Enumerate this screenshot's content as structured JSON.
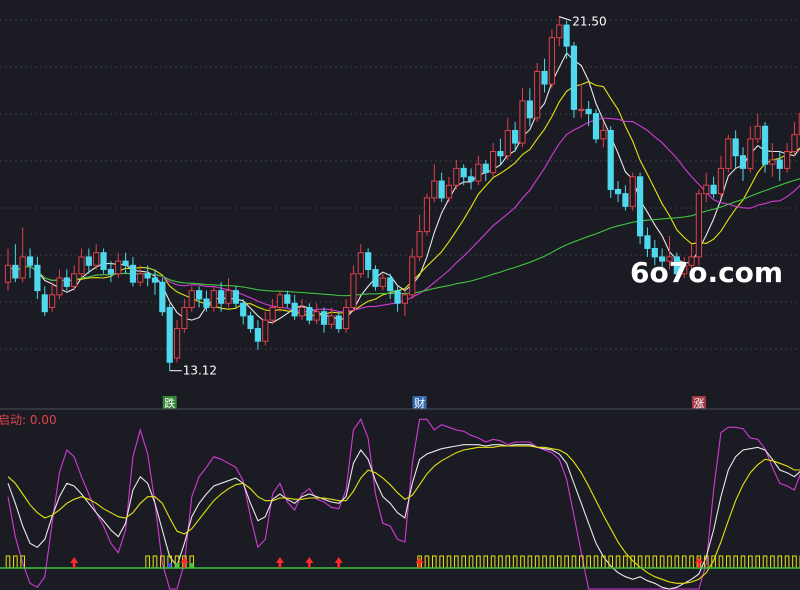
{
  "chart_data": {
    "type": "candlestick",
    "high_label": "21.50",
    "low_label": "13.12",
    "watermark": "6o7o.com",
    "event_markers": [
      {
        "text": "跌",
        "index": 22,
        "color": "#3a9a3a"
      },
      {
        "text": "财",
        "index": 56,
        "color": "#3b78c8"
      },
      {
        "text": "涨",
        "index": 94,
        "color": "#b8404a"
      }
    ],
    "indicator_label": "启动: 0.00",
    "colors": {
      "up": "#e0404a",
      "down": "#4fd8ee",
      "ma_white": "#e8e8e8",
      "ma_yellow": "#e6e20f",
      "ma_magenta": "#d23ad8",
      "ma_green": "#3fc43f",
      "bg": "#1b1c23",
      "grid": "#3a3c48",
      "signal_bar": "#e6e20f",
      "arrow": "#ff2a2a"
    },
    "price_axis": {
      "min": 12.5,
      "max": 21.8
    },
    "candles": [
      [
        15.2,
        15.6,
        16.0,
        15.0
      ],
      [
        15.6,
        15.3,
        16.1,
        15.2
      ],
      [
        15.3,
        15.8,
        16.5,
        15.2
      ],
      [
        15.8,
        15.6,
        16.0,
        15.3
      ],
      [
        15.6,
        15.0,
        15.8,
        14.8
      ],
      [
        14.9,
        14.5,
        15.1,
        14.4
      ],
      [
        14.6,
        14.9,
        15.2,
        14.5
      ],
      [
        14.9,
        15.3,
        15.5,
        14.8
      ],
      [
        15.3,
        15.1,
        15.5,
        15.0
      ],
      [
        15.1,
        15.4,
        15.6,
        15.0
      ],
      [
        15.4,
        15.8,
        16.0,
        15.3
      ],
      [
        15.8,
        15.6,
        16.0,
        15.4
      ],
      [
        15.6,
        15.9,
        16.1,
        15.5
      ],
      [
        15.9,
        15.5,
        16.0,
        15.4
      ],
      [
        15.5,
        15.4,
        15.7,
        15.2
      ],
      [
        15.4,
        15.7,
        15.9,
        15.3
      ],
      [
        15.7,
        15.6,
        15.9,
        15.4
      ],
      [
        15.6,
        15.2,
        15.8,
        15.1
      ],
      [
        15.2,
        15.4,
        15.6,
        15.1
      ],
      [
        15.4,
        15.3,
        15.6,
        15.1
      ],
      [
        15.3,
        15.2,
        15.5,
        14.9
      ],
      [
        15.2,
        14.5,
        15.3,
        14.4
      ],
      [
        14.6,
        13.3,
        14.7,
        13.1
      ],
      [
        13.4,
        14.1,
        14.3,
        13.3
      ],
      [
        14.1,
        14.6,
        14.8,
        14.0
      ],
      [
        14.6,
        15.0,
        15.1,
        14.5
      ],
      [
        15.0,
        14.8,
        15.1,
        14.6
      ],
      [
        14.8,
        14.6,
        15.0,
        14.5
      ],
      [
        14.6,
        15.0,
        15.1,
        14.5
      ],
      [
        15.0,
        14.7,
        15.2,
        14.5
      ],
      [
        14.7,
        15.0,
        15.3,
        14.6
      ],
      [
        15.0,
        14.7,
        15.1,
        14.6
      ],
      [
        14.7,
        14.4,
        14.8,
        14.2
      ],
      [
        14.4,
        14.1,
        14.5,
        14.0
      ],
      [
        14.1,
        13.8,
        14.3,
        13.6
      ],
      [
        13.8,
        14.3,
        14.5,
        13.7
      ],
      [
        14.3,
        14.6,
        14.8,
        14.2
      ],
      [
        14.6,
        14.9,
        15.0,
        14.5
      ],
      [
        14.9,
        14.7,
        15.0,
        14.6
      ],
      [
        14.7,
        14.4,
        14.9,
        14.3
      ],
      [
        14.4,
        14.6,
        14.8,
        14.3
      ],
      [
        14.6,
        14.3,
        14.7,
        14.2
      ],
      [
        14.3,
        14.5,
        14.7,
        14.2
      ],
      [
        14.5,
        14.2,
        14.6,
        14.0
      ],
      [
        14.2,
        14.4,
        14.6,
        14.1
      ],
      [
        14.4,
        14.1,
        14.5,
        14.0
      ],
      [
        14.1,
        14.6,
        14.8,
        14.0
      ],
      [
        14.6,
        15.4,
        15.6,
        14.5
      ],
      [
        15.4,
        15.9,
        16.1,
        15.3
      ],
      [
        15.9,
        15.5,
        16.0,
        15.3
      ],
      [
        15.5,
        15.1,
        15.6,
        15.0
      ],
      [
        15.1,
        15.3,
        15.4,
        15.0
      ],
      [
        15.3,
        15.0,
        15.4,
        14.8
      ],
      [
        15.0,
        14.7,
        15.1,
        14.5
      ],
      [
        14.7,
        14.9,
        15.0,
        14.4
      ],
      [
        14.9,
        15.8,
        16.0,
        14.8
      ],
      [
        15.8,
        16.4,
        16.8,
        15.7
      ],
      [
        16.4,
        17.2,
        17.3,
        16.3
      ],
      [
        17.2,
        17.6,
        18.0,
        17.1
      ],
      [
        17.6,
        17.2,
        17.8,
        17.1
      ],
      [
        17.2,
        17.5,
        17.7,
        17.1
      ],
      [
        17.5,
        17.9,
        18.1,
        17.4
      ],
      [
        17.9,
        17.7,
        18.0,
        17.5
      ],
      [
        17.7,
        17.6,
        17.9,
        17.4
      ],
      [
        17.6,
        18.0,
        18.2,
        17.5
      ],
      [
        18.0,
        17.8,
        18.1,
        17.6
      ],
      [
        17.8,
        18.3,
        18.5,
        17.7
      ],
      [
        18.3,
        18.2,
        18.6,
        18.0
      ],
      [
        18.2,
        18.8,
        19.1,
        18.1
      ],
      [
        18.8,
        18.5,
        19.0,
        18.3
      ],
      [
        18.5,
        19.5,
        19.8,
        18.4
      ],
      [
        19.5,
        19.1,
        19.8,
        18.9
      ],
      [
        19.1,
        20.2,
        20.4,
        19.0
      ],
      [
        20.2,
        19.9,
        20.5,
        19.7
      ],
      [
        19.9,
        21.0,
        21.2,
        19.8
      ],
      [
        21.0,
        21.3,
        21.5,
        20.8
      ],
      [
        21.3,
        20.8,
        21.4,
        20.5
      ],
      [
        20.8,
        19.3,
        20.9,
        19.1
      ],
      [
        19.3,
        19.3,
        19.9,
        19.1
      ],
      [
        19.3,
        19.2,
        19.5,
        18.9
      ],
      [
        19.2,
        18.6,
        19.3,
        18.5
      ],
      [
        18.6,
        18.8,
        19.0,
        18.4
      ],
      [
        18.8,
        17.4,
        18.9,
        17.2
      ],
      [
        17.4,
        17.3,
        17.6,
        17.1
      ],
      [
        17.3,
        17.0,
        17.5,
        16.9
      ],
      [
        17.0,
        17.7,
        17.8,
        16.9
      ],
      [
        17.7,
        16.3,
        17.8,
        16.1
      ],
      [
        16.3,
        16.0,
        16.5,
        15.8
      ],
      [
        16.0,
        15.8,
        16.2,
        15.6
      ],
      [
        15.8,
        15.7,
        16.0,
        15.5
      ],
      [
        15.7,
        15.8,
        16.3,
        15.5
      ],
      [
        15.8,
        15.4,
        15.9,
        15.3
      ],
      [
        15.4,
        15.6,
        15.8,
        15.3
      ],
      [
        15.6,
        15.8,
        16.1,
        15.5
      ],
      [
        15.8,
        17.3,
        17.4,
        15.6
      ],
      [
        17.3,
        17.5,
        17.8,
        17.1
      ],
      [
        17.5,
        17.3,
        17.7,
        17.2
      ],
      [
        17.3,
        17.9,
        18.2,
        17.2
      ],
      [
        17.9,
        18.6,
        18.7,
        17.8
      ],
      [
        18.6,
        18.2,
        18.8,
        17.9
      ],
      [
        18.2,
        17.9,
        18.4,
        17.6
      ],
      [
        17.9,
        18.6,
        18.9,
        17.8
      ],
      [
        18.6,
        18.9,
        19.2,
        18.5
      ],
      [
        18.9,
        18.0,
        19.0,
        17.8
      ],
      [
        18.0,
        18.1,
        18.5,
        17.7
      ],
      [
        18.1,
        17.9,
        18.3,
        17.6
      ],
      [
        17.9,
        18.3,
        18.5,
        17.8
      ],
      [
        18.3,
        18.7,
        19.0,
        18.2
      ],
      [
        18.7,
        19.2,
        19.4,
        18.6
      ],
      [
        19.2,
        20.4,
        20.6,
        19.0
      ]
    ],
    "kdj": {
      "range": [
        -10,
        110
      ],
      "k": [
        70,
        55,
        38,
        25,
        22,
        28,
        45,
        60,
        70,
        68,
        62,
        55,
        48,
        42,
        35,
        30,
        40,
        65,
        75,
        70,
        55,
        35,
        15,
        8,
        25,
        45,
        55,
        62,
        68,
        70,
        72,
        74,
        70,
        55,
        42,
        45,
        58,
        62,
        58,
        55,
        60,
        62,
        60,
        58,
        56,
        55,
        60,
        85,
        95,
        88,
        72,
        60,
        55,
        48,
        44,
        70,
        88,
        92,
        94,
        96,
        97,
        98,
        99,
        99,
        99,
        98,
        99,
        99,
        98,
        99,
        99,
        99,
        97,
        96,
        95,
        92,
        85,
        70,
        55,
        40,
        25,
        15,
        8,
        3,
        0,
        -2,
        0,
        -3,
        -5,
        -8,
        -10,
        -8,
        -5,
        -2,
        2,
        15,
        35,
        60,
        80,
        90,
        95,
        96,
        97,
        95,
        88,
        80,
        78,
        75,
        80,
        90
      ],
      "d": [
        75,
        70,
        62,
        54,
        48,
        44,
        46,
        50,
        55,
        58,
        60,
        58,
        55,
        51,
        48,
        45,
        44,
        48,
        55,
        60,
        60,
        55,
        44,
        34,
        32,
        36,
        43,
        50,
        57,
        62,
        66,
        69,
        70,
        66,
        60,
        57,
        57,
        59,
        59,
        58,
        58,
        59,
        59,
        59,
        58,
        57,
        57,
        64,
        74,
        80,
        78,
        74,
        69,
        63,
        58,
        61,
        69,
        77,
        83,
        87,
        90,
        93,
        95,
        96,
        97,
        97,
        97,
        98,
        98,
        98,
        98,
        98,
        97,
        97,
        96,
        95,
        92,
        86,
        78,
        68,
        57,
        46,
        36,
        26,
        18,
        12,
        7,
        3,
        0,
        -2,
        -4,
        -5,
        -5,
        -4,
        -2,
        3,
        12,
        26,
        42,
        57,
        69,
        78,
        84,
        88,
        87,
        85,
        83,
        80,
        80,
        84
      ],
      "j": [
        60,
        30,
        10,
        -5,
        -8,
        0,
        40,
        78,
        95,
        90,
        75,
        62,
        48,
        38,
        25,
        18,
        35,
        90,
        110,
        92,
        55,
        10,
        -15,
        -20,
        10,
        60,
        75,
        82,
        90,
        88,
        85,
        82,
        72,
        45,
        22,
        28,
        62,
        70,
        56,
        50,
        62,
        66,
        58,
        56,
        52,
        51,
        65,
        110,
        118,
        104,
        62,
        40,
        38,
        28,
        26,
        85,
        118,
        118,
        110,
        114,
        112,
        110,
        109,
        106,
        104,
        101,
        103,
        102,
        99,
        101,
        101,
        101,
        97,
        95,
        93,
        88,
        73,
        46,
        18,
        -10,
        -35,
        -50,
        -60,
        -68,
        -72,
        -70,
        -66,
        -68,
        -70,
        -72,
        -75,
        -70,
        -62,
        -55,
        -40,
        10,
        65,
        108,
        112,
        112,
        111,
        104,
        103,
        96,
        82,
        70,
        68,
        65,
        80,
        102
      ]
    },
    "signal_bars": [
      0,
      1,
      2,
      19,
      20,
      21,
      22,
      23,
      24,
      25,
      56,
      57,
      58,
      59,
      60,
      61,
      62,
      63,
      64,
      65,
      66,
      67,
      68,
      69,
      70,
      71,
      72,
      73,
      74,
      75,
      76,
      77,
      78,
      79,
      80,
      81,
      82,
      83,
      84,
      85,
      86,
      87,
      88,
      89,
      90,
      91,
      92,
      93,
      94,
      95,
      96,
      97,
      98,
      99,
      100,
      101,
      102,
      103,
      104,
      105,
      106,
      107,
      108,
      109
    ],
    "arrows": [
      9,
      24,
      37,
      41,
      45,
      56,
      94
    ],
    "small_bars": [
      {
        "index": 22,
        "color": "#2a4cff"
      },
      {
        "index": 23,
        "color": "#3fc43f"
      },
      {
        "index": 24,
        "color": "#3fc43f"
      },
      {
        "index": 25,
        "color": "#3fc43f"
      }
    ]
  }
}
